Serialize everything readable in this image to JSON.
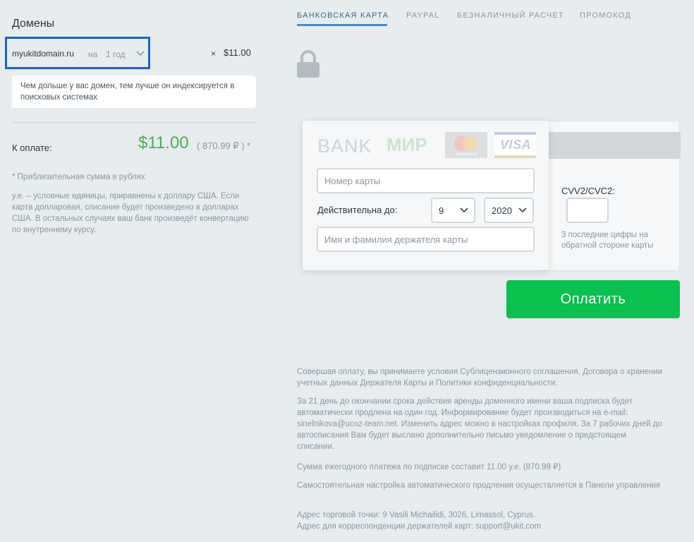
{
  "left": {
    "domains_title": "Домены",
    "domain": {
      "name": "myukitdomain.ru",
      "for": "на",
      "period": "1 год",
      "multiply": "×",
      "price": "$11.00"
    },
    "hint": "Чем дольше у вас домен, тем лучше он индексируется в поисковых системах",
    "pay_label": "К оплате:",
    "pay_amount": "$11.00",
    "pay_rub": "( 870.99 ₽ ) *",
    "note_approx": "* Приблизительная сумма в рублях",
    "note_units": "у.е. – условные единицы, приравнены к доллару США. Если карта долларовая, списание будет произведено в долларах США. В остальных случаях ваш банк произведёт конвертацию по внутреннему курсу."
  },
  "tabs": [
    {
      "label": "БАНКОВСКАЯ КАРТА",
      "active": true
    },
    {
      "label": "PAYPAL",
      "active": false
    },
    {
      "label": "БЕЗНАЛИЧНЫЙ РАСЧЕТ",
      "active": false
    },
    {
      "label": "ПРОМОКОД",
      "active": false
    }
  ],
  "card": {
    "bank_logo": "BANK",
    "mir_logo": "МИР",
    "mastercard_logo": "mastercard",
    "visa_logo": "VISA",
    "number_placeholder": "Номер карты",
    "valid_label": "Действительна до:",
    "month": "9",
    "year": "2020",
    "holder_placeholder": "Имя и фамилия держателя карты",
    "cvv_label": "CVV2/CVC2:",
    "cvv_hint": "3 последние цифры на обратной стороне карты"
  },
  "pay_button": "Оплатить",
  "legal": [
    "Совершая оплату, вы принимаете условия Сублицензионного соглашения, Договора о хранении учетных данных Держателя Карты и Политики конфиденциальности.",
    "За 21 день до окончании срока действия аренды доменного имени ваша подписка будет автоматически продлена на один год. Информирование будет производиться на e-mail: sinelnikova@ucoz-team.net. Изменить адрес можно в настройках профиля. За 7 рабочих дней до автосписания Вам будет выслано дополнительно письмо уведомление о предстоящем списании.",
    "Сумма ежегодного платежа по подписке составит 11.00 у.е. (870.99 ₽)",
    "Самостоятельная настройка автоматического продления осуществляется в Панели управления",
    "Адрес торговой точки: 9 Vasili Michailidi, 3026, Limassol, Cyprus.",
    "Адрес для корреспонденции держателей карт: support@ukit.com"
  ],
  "colors": {
    "accent_blue": "#1e63c4",
    "tab_underline": "#3b8fd9",
    "pay_green": "#0ac14f",
    "amount_green": "#4caf50"
  }
}
